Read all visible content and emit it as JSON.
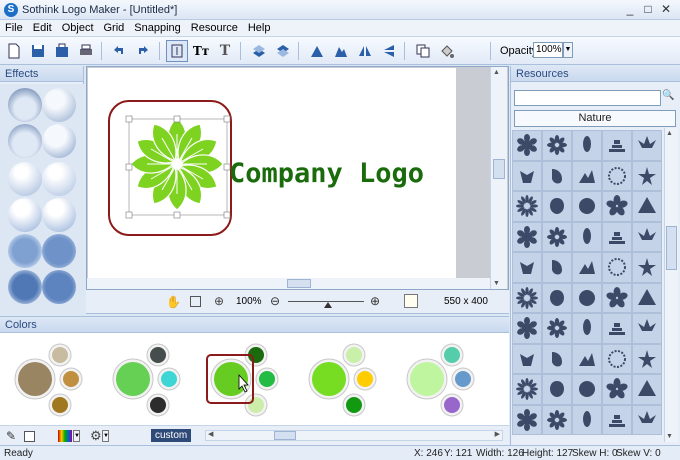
{
  "window": {
    "title": "Sothink Logo Maker - [Untitled*]",
    "app_icon": "S"
  },
  "menu": [
    "File",
    "Edit",
    "Object",
    "Grid",
    "Snapping",
    "Resource",
    "Help"
  ],
  "toolbar": {
    "opacity_label": "Opacity:",
    "opacity_value": "100%"
  },
  "effects": {
    "title": "Effects"
  },
  "canvas": {
    "logo_text": "Company Logo",
    "logo_color": "#1a6b0c",
    "flower_color": "#7ed320"
  },
  "zoom": {
    "value": "100%",
    "size": "550 x 400"
  },
  "resources": {
    "title": "Resources",
    "category": "Nature"
  },
  "colors": {
    "title": "Colors",
    "custom_label": "custom"
  },
  "color_schemes": [
    {
      "big": "#9a8563",
      "smalls": [
        "#c8bca0",
        "#c09040",
        "#a07820"
      ]
    },
    {
      "big": "#66d055",
      "smalls": [
        "#454d4d",
        "#3ed5d5",
        "#2d2d2d"
      ]
    },
    {
      "big": "#66cc22",
      "smalls": [
        "#1a6b0c",
        "#22bb44",
        "#cceeaa"
      ]
    },
    {
      "big": "#77dd22",
      "smalls": [
        "#c8f0a8",
        "#ffcc00",
        "#119911"
      ]
    },
    {
      "big": "#c0f5a0",
      "smalls": [
        "#55ccaa",
        "#6699cc",
        "#9966cc"
      ]
    }
  ],
  "status": {
    "ready": "Ready",
    "x": "X: 246",
    "y": "Y: 121",
    "width": "Width: 126",
    "height": "Height: 127",
    "skew_h": "Skew H: 0",
    "skew_v": "Skew V: 0"
  }
}
